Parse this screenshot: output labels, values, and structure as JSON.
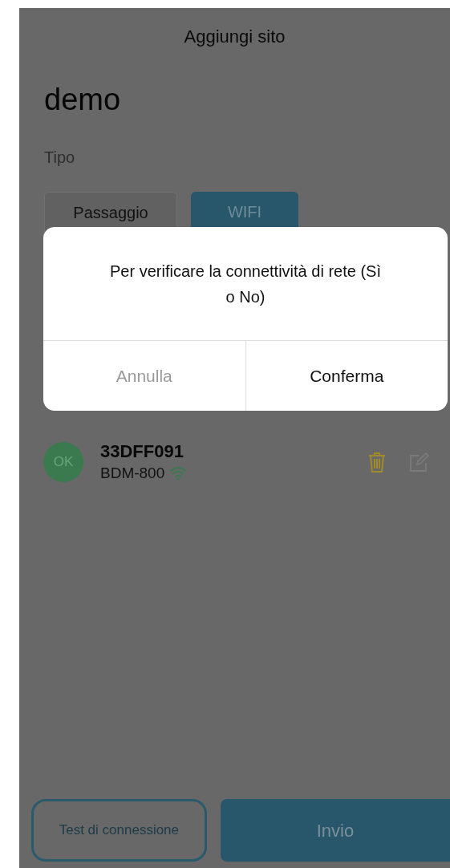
{
  "header": {
    "title": "Aggiungi sito"
  },
  "site_name": "demo",
  "type_field": {
    "label": "Tipo",
    "options": [
      {
        "label": "Passaggio",
        "selected": false
      },
      {
        "label": "WIFI",
        "selected": true
      }
    ]
  },
  "dialog": {
    "message": "Per verificare la connettività di rete (Sì o No)",
    "cancel": "Annulla",
    "confirm": "Conferma"
  },
  "devices": [
    {
      "status": "OK",
      "id": "33DFF091",
      "model": "BDM-800"
    }
  ],
  "footer": {
    "test_button": "Test di connessione",
    "submit_button": "Invio"
  }
}
